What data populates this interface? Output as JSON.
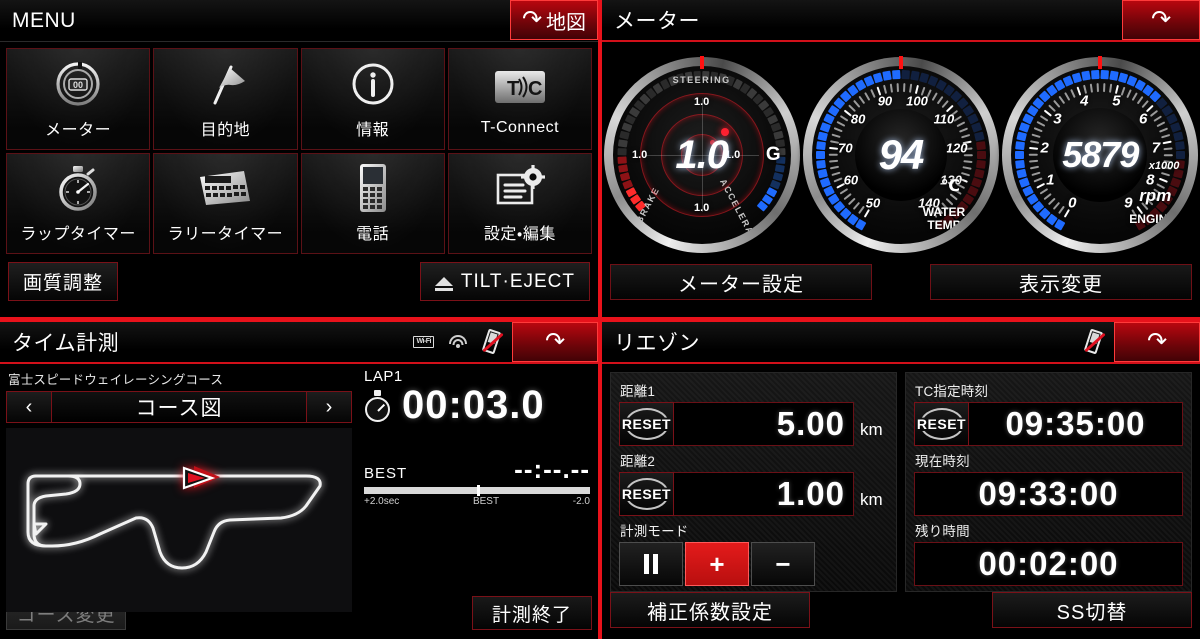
{
  "menu": {
    "title": "MENU",
    "status_icons": [
      "phone-disconnected-icon"
    ],
    "map_button": "地図",
    "items": [
      {
        "label": "メーター",
        "icon": "meter-icon"
      },
      {
        "label": "目的地",
        "icon": "flag-icon"
      },
      {
        "label": "情報",
        "icon": "info-icon"
      },
      {
        "label": "T-Connect",
        "icon": "tconnect-icon"
      },
      {
        "label": "ラップタイマー",
        "icon": "stopwatch-icon"
      },
      {
        "label": "ラリータイマー",
        "icon": "rally-timer-icon"
      },
      {
        "label": "電話",
        "icon": "phone-icon"
      },
      {
        "label": "設定・編集",
        "icon": "settings-edit-icon"
      }
    ],
    "picture_button": "画質調整",
    "tilt_eject_button": "TILT·EJECT"
  },
  "meter": {
    "title": "メーター",
    "back_button": "back-arrow-icon",
    "settings_button": "メーター設定",
    "display_button": "表示変更",
    "gauges": [
      {
        "name": "g-force",
        "value": "1.0",
        "unit": "G",
        "ring_labels": [
          "1.0",
          "1.0",
          "1.0",
          "1.0"
        ],
        "arc_labels": [
          "STEERING",
          "BRAKE",
          "ACCELERATOR"
        ]
      },
      {
        "name": "water-temp",
        "value": "94",
        "unit": "℃",
        "caption": "WATER TEMP",
        "ticks": [
          "50",
          "60",
          "70",
          "80",
          "90",
          "100",
          "110",
          "120",
          "130",
          "140"
        ],
        "min": 50,
        "max": 140
      },
      {
        "name": "tachometer",
        "value": "5879",
        "unit": "rpm",
        "multiplier": "x1000",
        "caption": "ENGINE",
        "ticks": [
          "0",
          "1",
          "2",
          "3",
          "4",
          "5",
          "6",
          "7",
          "8",
          "9"
        ],
        "min": 0,
        "max": 9000
      }
    ]
  },
  "time": {
    "title": "タイム計測",
    "status_icons": [
      "wifi-badge-icon",
      "wifi-signal-icon",
      "phone-disconnected-icon"
    ],
    "back_button": "back-arrow-icon",
    "course_name": "富士スピードウェイレーシングコース",
    "prev_arrow": "‹",
    "next_arrow": "›",
    "view_label": "コース図",
    "lap_label": "LAP1",
    "lap_time": "00:03.0",
    "best_label": "BEST",
    "best_time": "--:--.--",
    "scale_left": "+2.0sec",
    "scale_center": "BEST",
    "scale_right": "-2.0",
    "change_course_button": "コース変更",
    "stop_button": "計測終了"
  },
  "liaison": {
    "title": "リエゾン",
    "status_icons": [
      "phone-disconnected-icon"
    ],
    "back_button": "back-arrow-icon",
    "distance1": {
      "label": "距離1",
      "reset": "RESET",
      "value": "5.00",
      "unit": "km"
    },
    "distance2": {
      "label": "距離2",
      "reset": "RESET",
      "value": "1.00",
      "unit": "km"
    },
    "mode": {
      "label": "計測モード",
      "pause": "pause-icon",
      "plus": "+",
      "minus": "−",
      "selected": "plus"
    },
    "tc_time": {
      "label": "TC指定時刻",
      "reset": "RESET",
      "value": "09:35:00"
    },
    "current_time": {
      "label": "現在時刻",
      "value": "09:33:00"
    },
    "remaining": {
      "label": "残り時間",
      "value": "00:02:00"
    },
    "correction_button": "補正係数設定",
    "ss_button": "SS切替"
  },
  "colors": {
    "accent_red": "#e8121b",
    "panel_black": "#000000",
    "gauge_blue": "#1366ff",
    "gauge_red": "#d81020",
    "text_white": "#ffffff"
  }
}
